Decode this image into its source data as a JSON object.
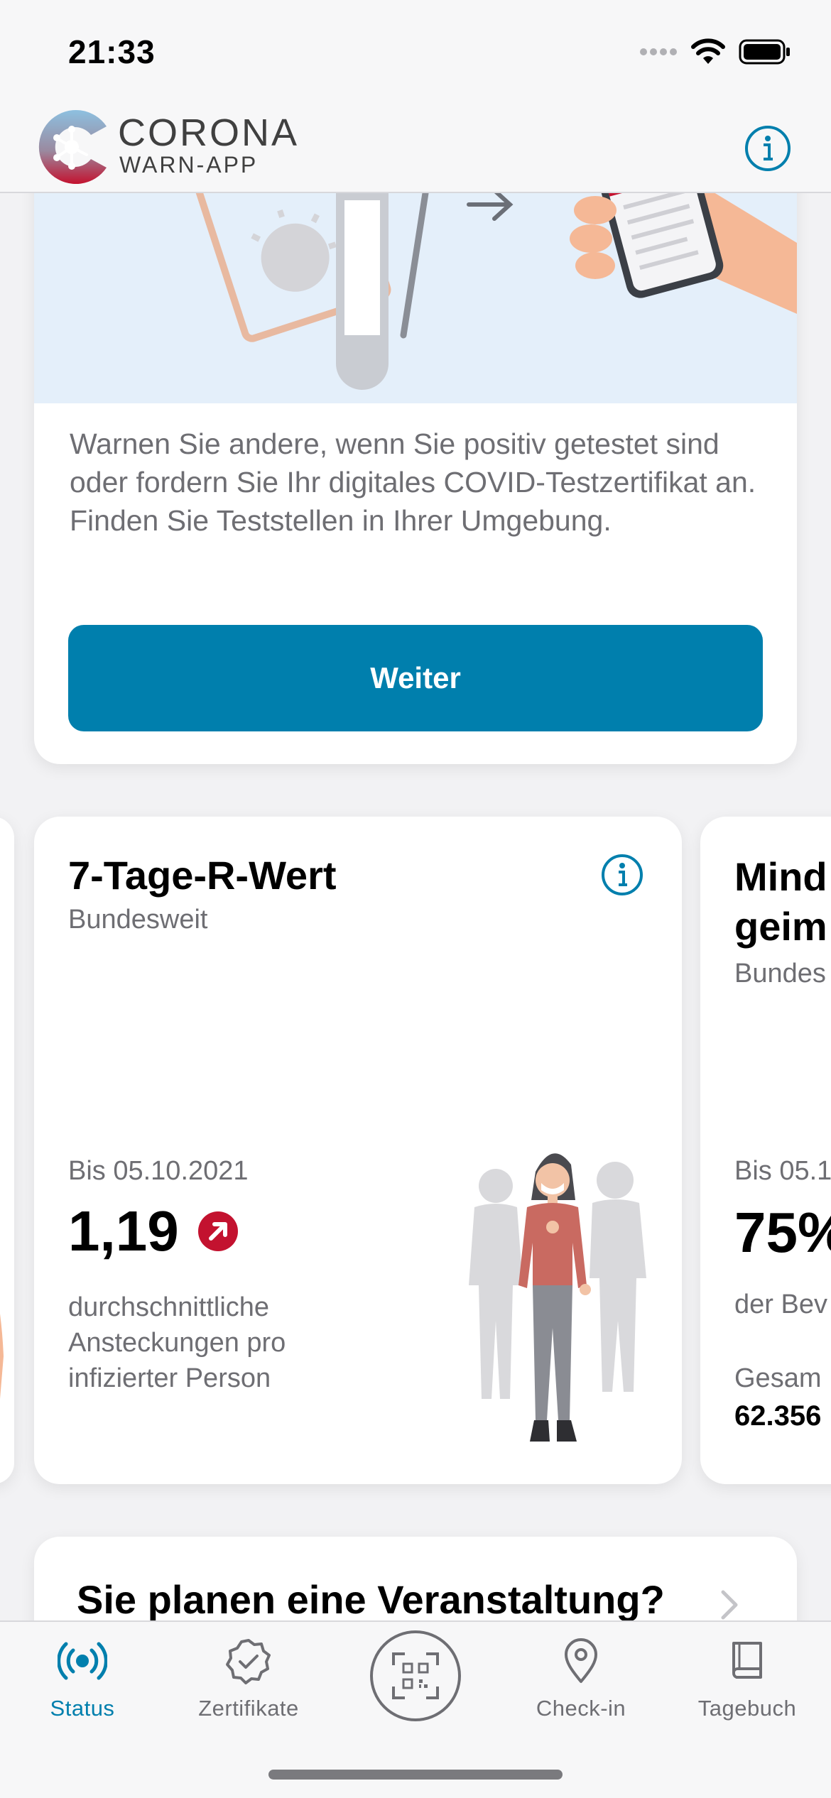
{
  "status_bar": {
    "time": "21:33"
  },
  "header": {
    "logo_title": "CORONA",
    "logo_subtitle": "WARN-APP",
    "info_icon": "info-icon"
  },
  "test_card": {
    "text": "Warnen Sie andere, wenn Sie positiv getestet sind oder fordern Sie Ihr digitales COVID-Testzertifikat an. Finden Sie Teststellen in Ihrer Umgebung.",
    "button_label": "Weiter"
  },
  "rwert_card": {
    "title": "7-Tage-R-Wert",
    "subtitle": "Bundesweit",
    "date": "Bis 05.10.2021",
    "value": "1,19",
    "trend": "up",
    "description": "durchschnittliche Ansteckungen pro infizierter Person"
  },
  "vaccination_card": {
    "title_line1": "Mind",
    "title_line2": "geim",
    "subtitle": "Bundes",
    "date": "Bis 05.1",
    "value": "75%",
    "description": "der Bev",
    "total_label": "Gesam",
    "total_value": "62.356"
  },
  "event_card": {
    "title": "Sie planen eine Veranstaltung?"
  },
  "tab_bar": {
    "tabs": [
      {
        "label": "Status",
        "icon": "broadcast-icon",
        "active": true
      },
      {
        "label": "Zertifikate",
        "icon": "certificate-badge-icon",
        "active": false
      },
      {
        "label": "",
        "icon": "qr-scan-icon",
        "active": false
      },
      {
        "label": "Check-in",
        "icon": "location-pin-icon",
        "active": false
      },
      {
        "label": "Tagebuch",
        "icon": "book-icon",
        "active": false
      }
    ]
  },
  "colors": {
    "accent": "#007fad",
    "trend_red": "#c3122f",
    "text_secondary": "#6e6e73"
  }
}
